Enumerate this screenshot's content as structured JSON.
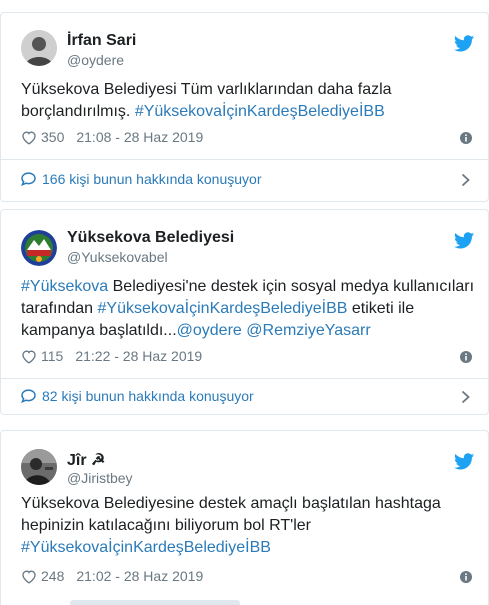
{
  "colors": {
    "link": "#2b7bb9",
    "text": "#1c2022",
    "muted": "#697882",
    "border": "#e1e8ed",
    "twitter": "#1da1f2"
  },
  "tweets": [
    {
      "author_name": "İrfan Sari",
      "author_handle": "@oydere",
      "avatar_icon": "person-silhouette",
      "text_parts": [
        {
          "text": "Yüksekova Belediyesi Tüm varlıklarından daha fazla borçlandırılmış. ",
          "link": false
        },
        {
          "text": "#YüksekovaİçinKardeşBelediyeİBB",
          "link": true
        }
      ],
      "likes": "350",
      "timestamp": "21:08 - 28 Haz 2019",
      "conversation": "166 kişi bunun hakkında konuşuyor"
    },
    {
      "author_name": "Yüksekova Belediyesi",
      "author_handle": "@Yuksekovabel",
      "avatar_icon": "municipality-logo",
      "text_parts": [
        {
          "text": "#Yüksekova",
          "link": true
        },
        {
          "text": " Belediyesi'ne destek için sosyal medya kullanıcıları tarafından ",
          "link": false
        },
        {
          "text": "#YüksekovaİçinKardeşBelediyeİBB",
          "link": true
        },
        {
          "text": " etiketi ile kampanya başlatıldı...",
          "link": false
        },
        {
          "text": "@oydere",
          "link": true
        },
        {
          "text": " ",
          "link": false
        },
        {
          "text": "@RemziyeYasarr",
          "link": true
        }
      ],
      "likes": "115",
      "timestamp": "21:22 - 28 Haz 2019",
      "conversation": "82 kişi bunun hakkında konuşuyor"
    },
    {
      "author_name": "Jîr ☭",
      "author_handle": "@Jiristbey",
      "avatar_icon": "person-photo",
      "text_parts": [
        {
          "text": "Yüksekova Belediyesine destek amaçlı başlatılan hashtaga hepinizin katılacağını biliyorum bol RT'ler ",
          "link": false
        },
        {
          "text": "#YüksekovaİçinKardeşBelediyeİBB",
          "link": true
        }
      ],
      "likes": "248",
      "timestamp": "21:02 - 28 Haz 2019",
      "conversation": ""
    }
  ]
}
